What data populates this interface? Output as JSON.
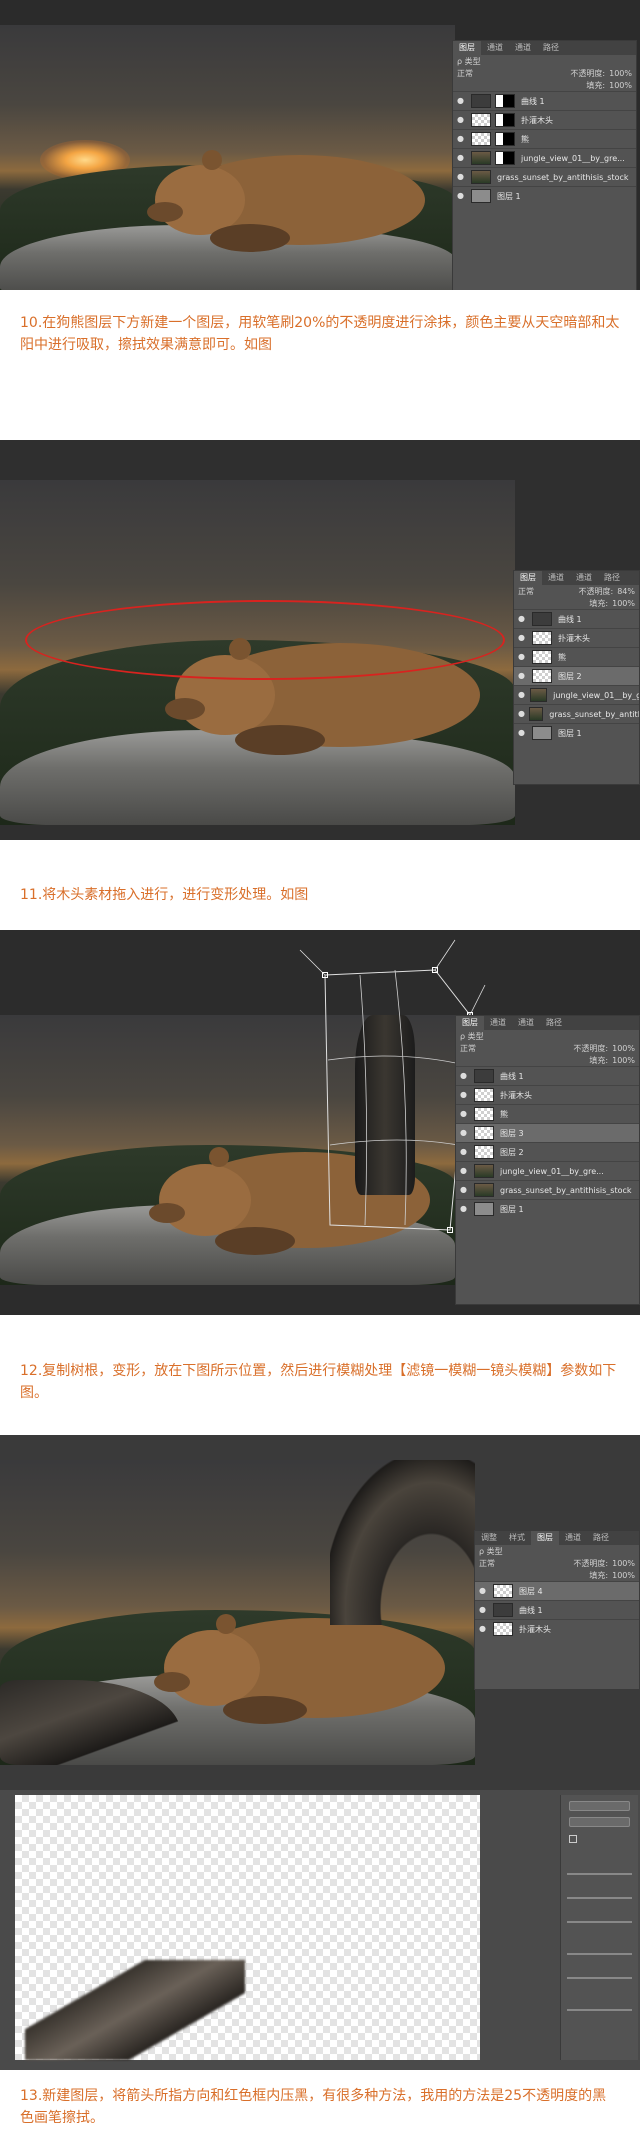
{
  "shot1": {
    "layers_panel": {
      "tabs": [
        "图层",
        "通道",
        "通道",
        "路径"
      ],
      "kind_label": "ρ 类型",
      "blend_mode": "正常",
      "opacity_label": "不透明度:",
      "opacity_value": "100%",
      "fill_label": "填充:",
      "fill_value": "100%",
      "layers": [
        {
          "name": "曲线 1",
          "thumb": "adj"
        },
        {
          "name": "扑灌木头",
          "thumb": "checker"
        },
        {
          "name": "熊",
          "thumb": "checker"
        },
        {
          "name": "jungle_view_01__by_gre...",
          "thumb": "photo2"
        },
        {
          "name": "grass_sunset_by_antithisis_stock",
          "thumb": "photo2"
        },
        {
          "name": "图层 1",
          "thumb": "grey"
        }
      ],
      "footer_icons": [
        "link-icon",
        "fx-icon",
        "mask-icon",
        "adjust-icon",
        "folder-icon",
        "new-layer-icon",
        "trash-icon"
      ]
    }
  },
  "caption10": "10.在狗熊图层下方新建一个图层，用软笔刷20%的不透明度进行涂抹，颜色主要从天空暗部和太阳中进行吸取，擦拭效果满意即可。如图",
  "shot2": {
    "layers_panel": {
      "tabs": [
        "图层",
        "通道",
        "通道",
        "路径"
      ],
      "blend_mode": "正常",
      "opacity_label": "不透明度:",
      "opacity_value": "84%",
      "fill_label": "填充:",
      "fill_value": "100%",
      "layers": [
        {
          "name": "曲线 1",
          "thumb": "adj"
        },
        {
          "name": "扑灌木头",
          "thumb": "checker"
        },
        {
          "name": "熊",
          "thumb": "checker"
        },
        {
          "name": "图层 2",
          "thumb": "checker",
          "selected": true
        },
        {
          "name": "jungle_view_01__by_gre...",
          "thumb": "photo2"
        },
        {
          "name": "grass_sunset_by_antithisis_stock",
          "thumb": "photo2"
        },
        {
          "name": "图层 1",
          "thumb": "grey"
        }
      ]
    }
  },
  "caption11": "11.将木头素材拖入进行，进行变形处理。如图",
  "shot3": {
    "layers_panel": {
      "tabs": [
        "图层",
        "通道",
        "通道",
        "路径"
      ],
      "kind_label": "ρ 类型",
      "blend_mode": "正常",
      "opacity_label": "不透明度:",
      "opacity_value": "100%",
      "fill_label": "填充:",
      "fill_value": "100%",
      "layers": [
        {
          "name": "曲线 1",
          "thumb": "adj"
        },
        {
          "name": "扑灌木头",
          "thumb": "checker"
        },
        {
          "name": "熊",
          "thumb": "checker"
        },
        {
          "name": "图层 3",
          "thumb": "checker",
          "selected": true
        },
        {
          "name": "图层 2",
          "thumb": "checker"
        },
        {
          "name": "jungle_view_01__by_gre...",
          "thumb": "photo2"
        },
        {
          "name": "grass_sunset_by_antithisis_stock",
          "thumb": "photo2"
        },
        {
          "name": "图层 1",
          "thumb": "grey"
        }
      ]
    }
  },
  "caption12": "12.复制树根，变形，放在下图所示位置，然后进行模糊处理【滤镜一模糊一镜头模糊】参数如下图。",
  "shot4": {
    "layers_panel": {
      "tabs": [
        "调整",
        "样式",
        "图层",
        "通道",
        "路径"
      ],
      "kind_label": "ρ 类型",
      "blend_mode": "正常",
      "opacity_label": "不透明度:",
      "opacity_value": "100%",
      "fill_label": "填充:",
      "fill_value": "100%",
      "layers": [
        {
          "name": "图层 4",
          "thumb": "checker",
          "selected": true
        },
        {
          "name": "曲线 1",
          "thumb": "adj"
        },
        {
          "name": "扑灌木头",
          "thumb": "checker"
        }
      ]
    }
  },
  "caption13": "13.新建图层，将箭头所指方向和红色框内压黑，有很多种方法，我用的方法是25不透明度的黑色画笔擦拭。",
  "colors": {
    "caption": "#d96f2a",
    "ellipse": "#d8231f",
    "panel": "#535353"
  }
}
